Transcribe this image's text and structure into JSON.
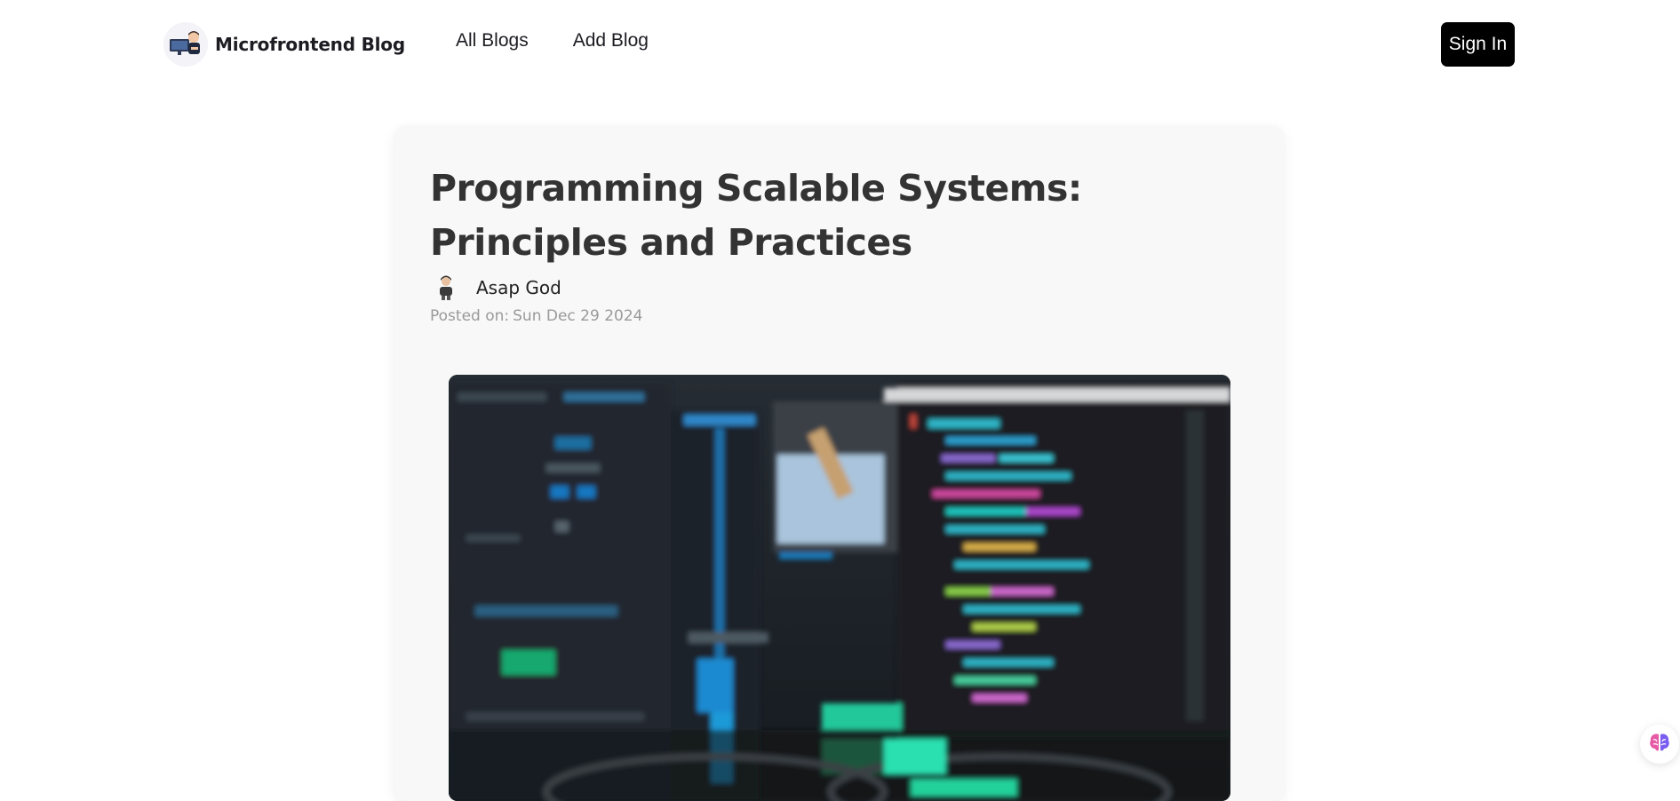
{
  "header": {
    "brand_name": "Microfrontend Blog",
    "brand_icon": "developer-avatar-icon",
    "nav": [
      {
        "label": "All Blogs"
      },
      {
        "label": "Add Blog"
      }
    ],
    "sign_in_label": "Sign In"
  },
  "article": {
    "title": "Programming Scalable Systems: Principles and Practices",
    "author_name": "Asap God",
    "author_icon": "author-avatar-icon",
    "posted_label": "Posted on:",
    "posted_date": "Sun Dec 29 2024",
    "hero_image": "blurred-code-monitor-photo"
  },
  "floating_widget": {
    "icon": "brain-icon"
  },
  "colors": {
    "sign_in_bg": "#000000",
    "card_bg": "#f8f8f8",
    "title": "#333333",
    "muted": "#9a9a9a"
  }
}
